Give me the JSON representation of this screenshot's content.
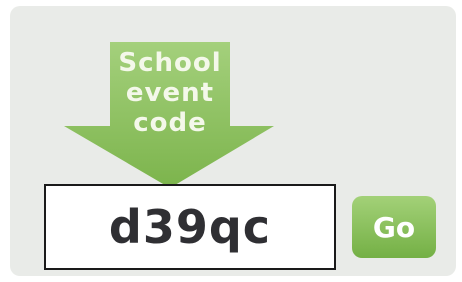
{
  "prompt": {
    "lines": [
      "School",
      "event",
      "code"
    ],
    "arrow_color": "#8cc063"
  },
  "code_field": {
    "value": "d39qc"
  },
  "go_button": {
    "label": "Go",
    "color": "#80b851"
  }
}
